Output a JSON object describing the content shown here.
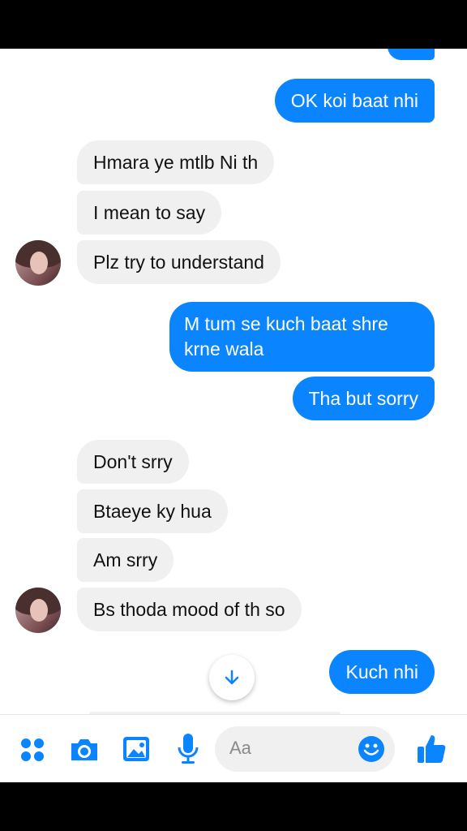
{
  "messages": [
    {
      "side": "out",
      "text": "OK koi baat nhi"
    },
    {
      "side": "in",
      "text": "Hmara ye mtlb Ni th"
    },
    {
      "side": "in",
      "text": "I mean to say"
    },
    {
      "side": "in",
      "text": "Plz try to understand"
    },
    {
      "side": "out",
      "text": "M tum se kuch baat  shre krne wala"
    },
    {
      "side": "out",
      "text": "Tha but sorry"
    },
    {
      "side": "in",
      "text": "Don't srry"
    },
    {
      "side": "in",
      "text": "Btaeye ky hua"
    },
    {
      "side": "in",
      "text": "Am srry"
    },
    {
      "side": "in",
      "text": "Bs thoda mood of th so"
    },
    {
      "side": "out",
      "text": "Kuch nhi"
    }
  ],
  "composer": {
    "placeholder": "Aa",
    "icons": [
      "apps-icon",
      "camera-icon",
      "gallery-icon",
      "microphone-icon",
      "emoji-icon",
      "like-icon"
    ]
  },
  "scroll_icon": "arrow-down-icon",
  "colors": {
    "accent": "#0a84ff",
    "incoming_bg": "#f0f0f0"
  }
}
